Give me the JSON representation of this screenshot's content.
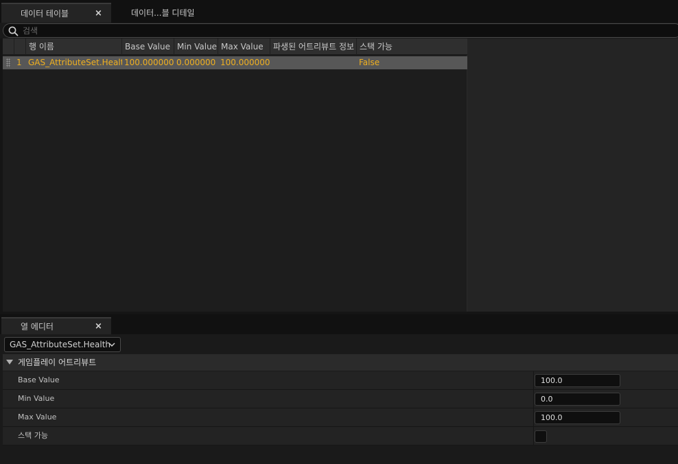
{
  "tabs": {
    "data_table": {
      "label": "데이터 테이블",
      "close": "×"
    },
    "row_details": {
      "label": "데이터...블 디테일"
    }
  },
  "search": {
    "placeholder": "검색",
    "value": ""
  },
  "table": {
    "columns": [
      {
        "key": "num",
        "label": ""
      },
      {
        "key": "row_name",
        "label": "행 이름"
      },
      {
        "key": "base",
        "label": "Base Value"
      },
      {
        "key": "min",
        "label": "Min Value"
      },
      {
        "key": "max",
        "label": "Max Value"
      },
      {
        "key": "derived",
        "label": "파생된 어트리뷰트 정보"
      },
      {
        "key": "stack",
        "label": "스택 가능"
      }
    ],
    "rows": [
      {
        "num": "1",
        "row_name": "GAS_AttributeSet.Health",
        "base": "100.000000",
        "min": "0.000000",
        "max": "100.000000",
        "derived": "",
        "stack": "False"
      }
    ]
  },
  "row_editor": {
    "tab_label": "열 에디터",
    "close": "×",
    "selected_row": "GAS_AttributeSet.Health",
    "category": "게임플레이 어트리뷰트",
    "properties": [
      {
        "label": "Base Value",
        "value": "100.0"
      },
      {
        "label": "Min Value",
        "value": "0.0"
      },
      {
        "label": "Max Value",
        "value": "100.0"
      },
      {
        "label": "스택 가능",
        "checked": false
      }
    ]
  },
  "colors": {
    "row_text": "#f0b020",
    "selected_row_bg": "#575757",
    "panel_bg": "#1d1d1d"
  }
}
